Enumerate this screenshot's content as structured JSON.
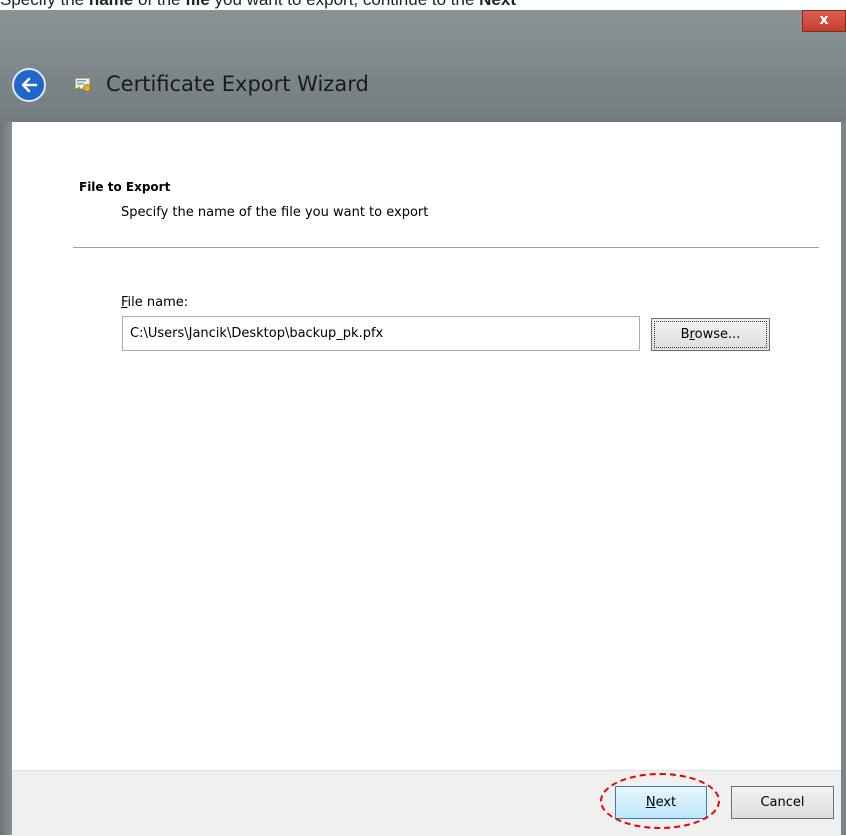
{
  "caption": {
    "p1": "Specify the ",
    "b1": "name",
    "p2": " of the ",
    "b2": "file",
    "p3": " you want to export, continue to the ",
    "b3": "Next"
  },
  "window": {
    "title": "Certificate Export Wizard",
    "close_label": "x",
    "back_icon": "back-arrow-icon",
    "wizard_icon": "certificate-icon"
  },
  "section": {
    "title": "File to Export",
    "subtitle": "Specify the name of the file you want to export"
  },
  "file_field": {
    "label_hotkey": "F",
    "label_rest": "ile name:",
    "value": "C:\\Users\\Jancik\\Desktop\\backup_pk.pfx"
  },
  "browse_button": {
    "hotkey_before": "B",
    "hotkey": "r",
    "rest": "owse..."
  },
  "footer": {
    "next_hotkey": "N",
    "next_rest": "ext",
    "cancel_label": "Cancel"
  },
  "colors": {
    "accent": "#1e66c9",
    "highlight": "#e60000",
    "close": "#c7473a"
  }
}
